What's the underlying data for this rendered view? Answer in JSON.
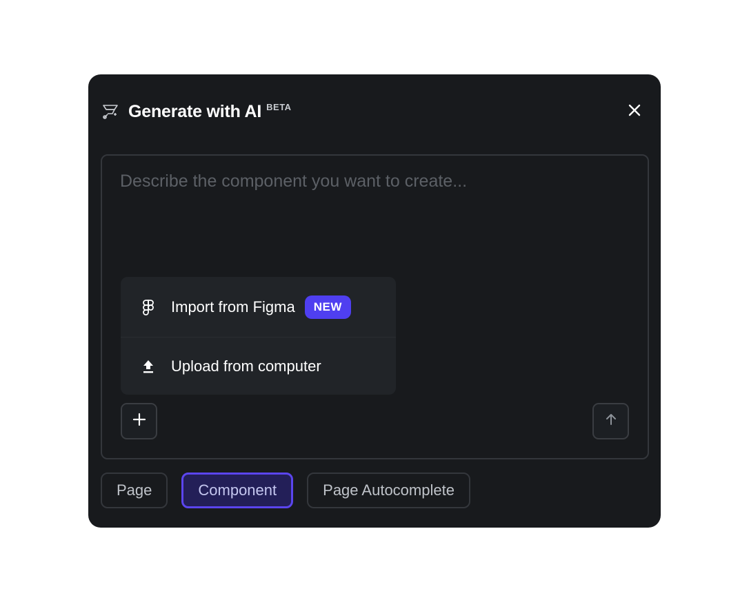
{
  "dialog": {
    "title": "Generate with AI",
    "badge": "BETA",
    "close_icon": "close-icon",
    "logo_icon": "ai-generate-icon"
  },
  "prompt": {
    "placeholder": "Describe the component you want to create...",
    "value": ""
  },
  "attach_menu": {
    "items": [
      {
        "label": "Import from Figma",
        "icon": "figma-icon",
        "badge": "NEW"
      },
      {
        "label": "Upload from computer",
        "icon": "upload-icon"
      }
    ]
  },
  "actions": {
    "add_icon": "plus-icon",
    "send_icon": "arrow-up-icon"
  },
  "modes": {
    "items": [
      {
        "label": "Page"
      },
      {
        "label": "Component"
      },
      {
        "label": "Page Autocomplete"
      }
    ],
    "selected": "Component"
  },
  "colors": {
    "dialog_bg": "#181a1d",
    "accent": "#5b45ee",
    "badge_bg": "#4f3ff0",
    "menu_bg": "#212428"
  }
}
